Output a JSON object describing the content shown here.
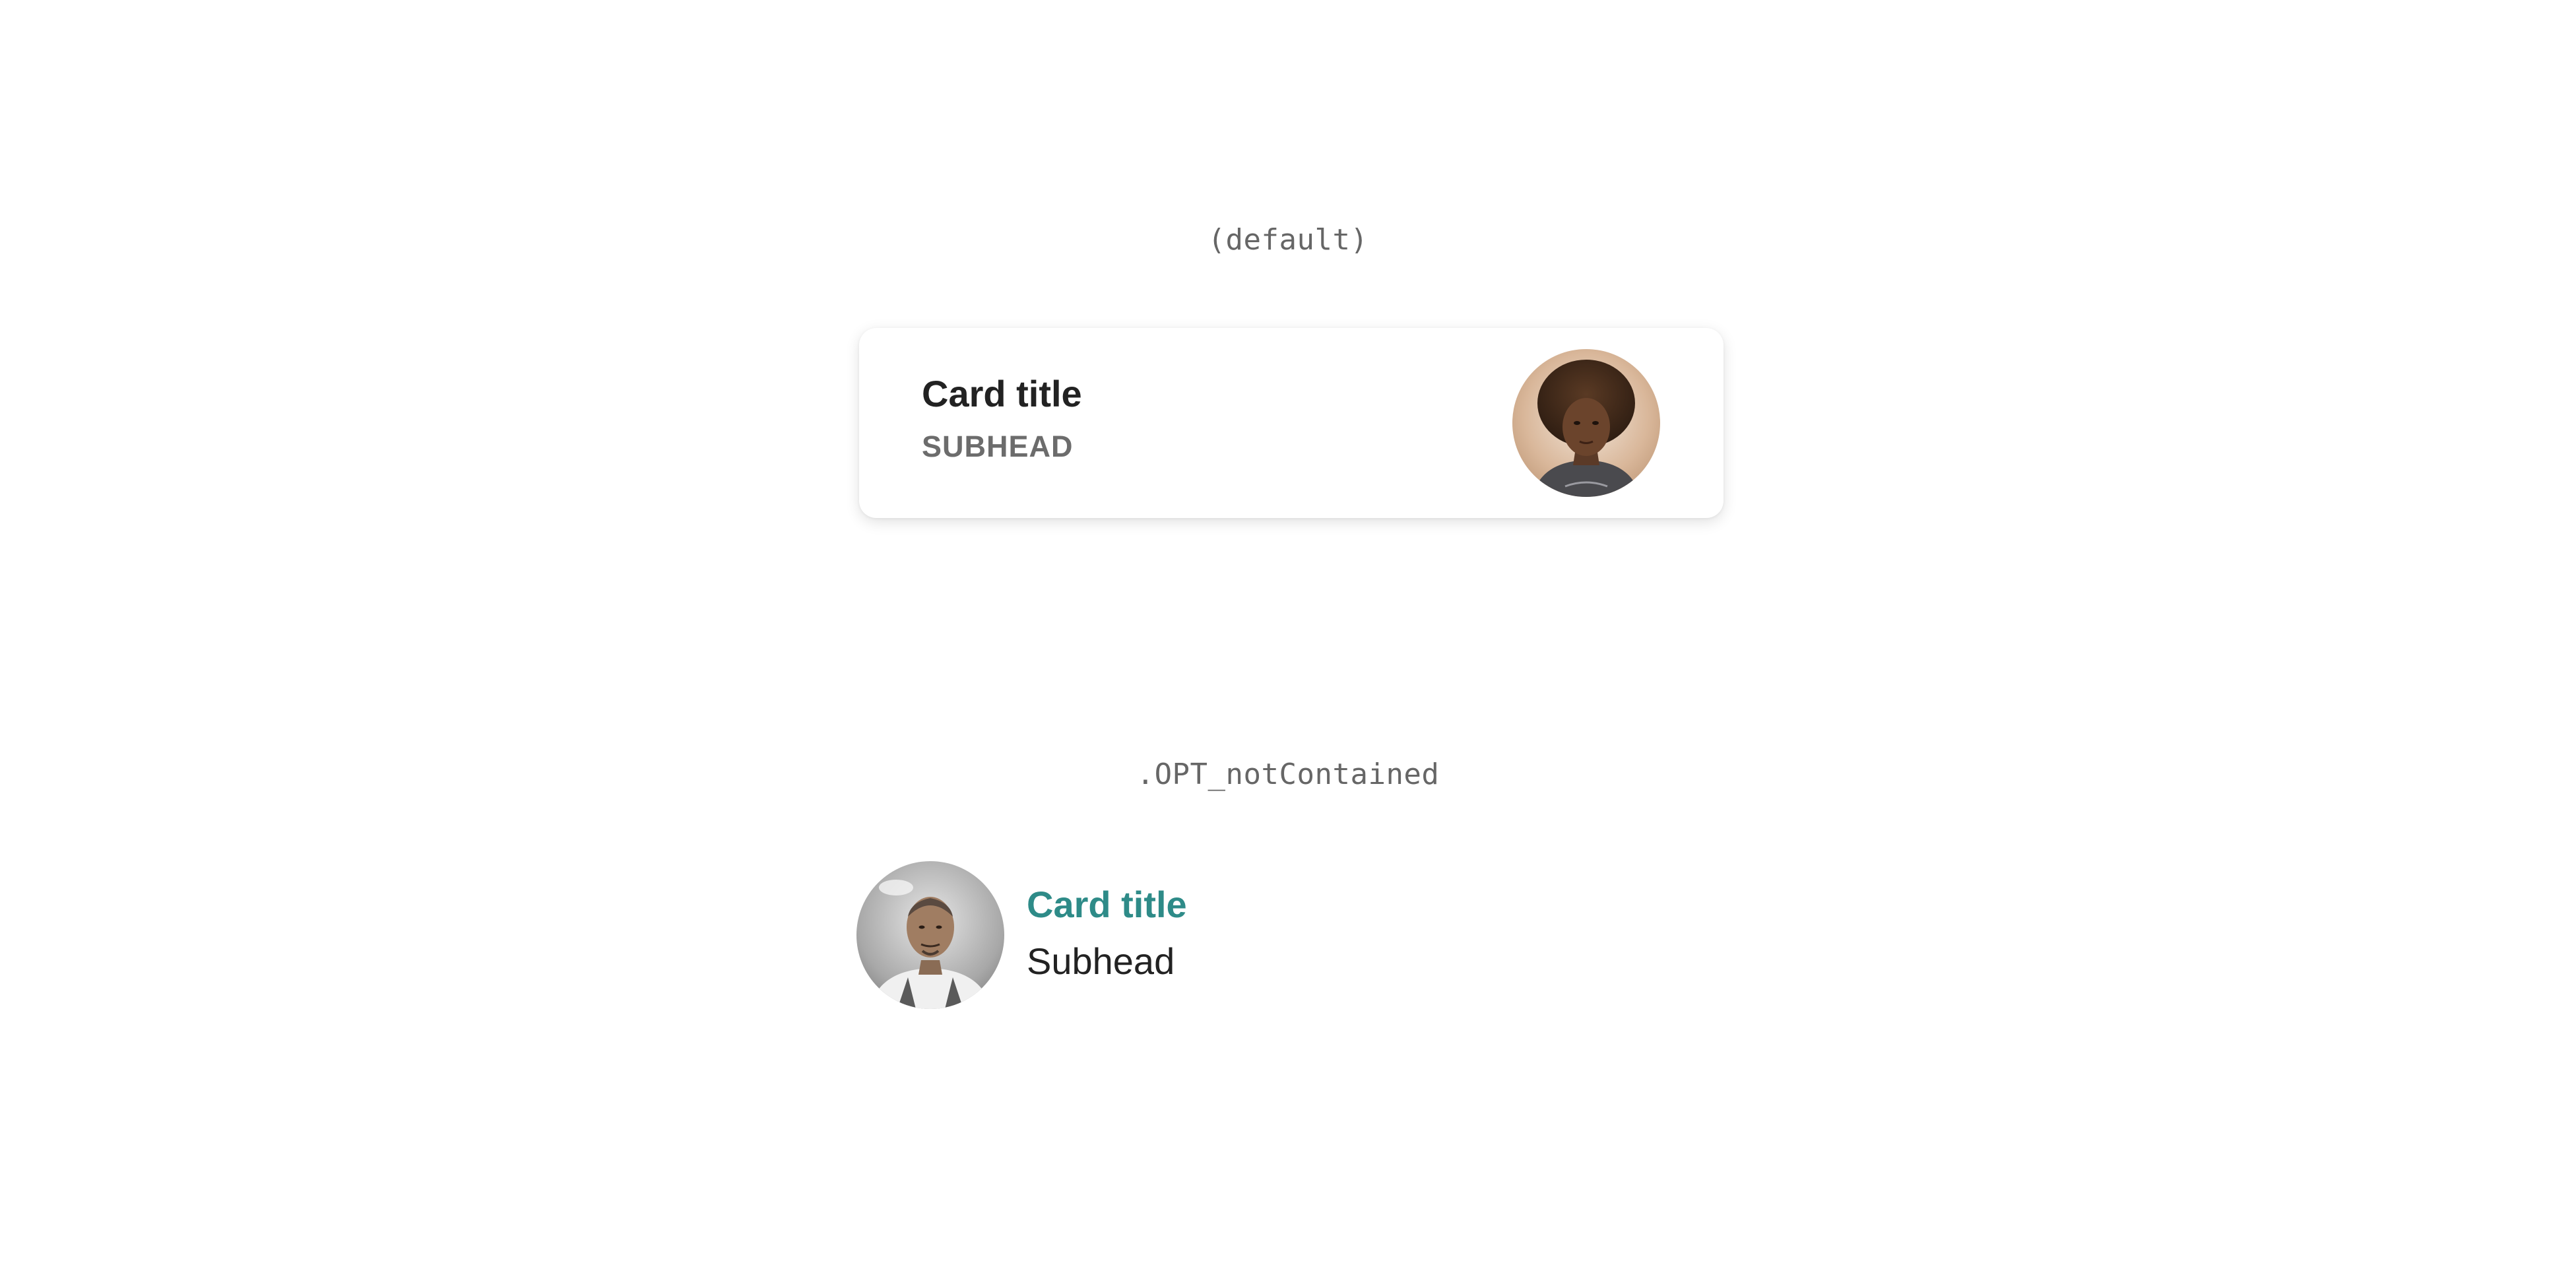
{
  "variants": [
    {
      "label": "(default)",
      "card": {
        "title": "Card title",
        "subhead": "SUBHEAD",
        "avatar_icon": "woman-portrait-avatar"
      }
    },
    {
      "label": ".OPT_notContained",
      "card": {
        "title": "Card title",
        "subhead": "Subhead",
        "avatar_icon": "man-chef-portrait-avatar"
      }
    }
  ],
  "colors": {
    "title_default": "#222222",
    "subhead_default": "#6c6c6c",
    "title_not_contained": "#2e8b88",
    "subhead_not_contained": "#222222",
    "card_background": "#ffffff"
  }
}
